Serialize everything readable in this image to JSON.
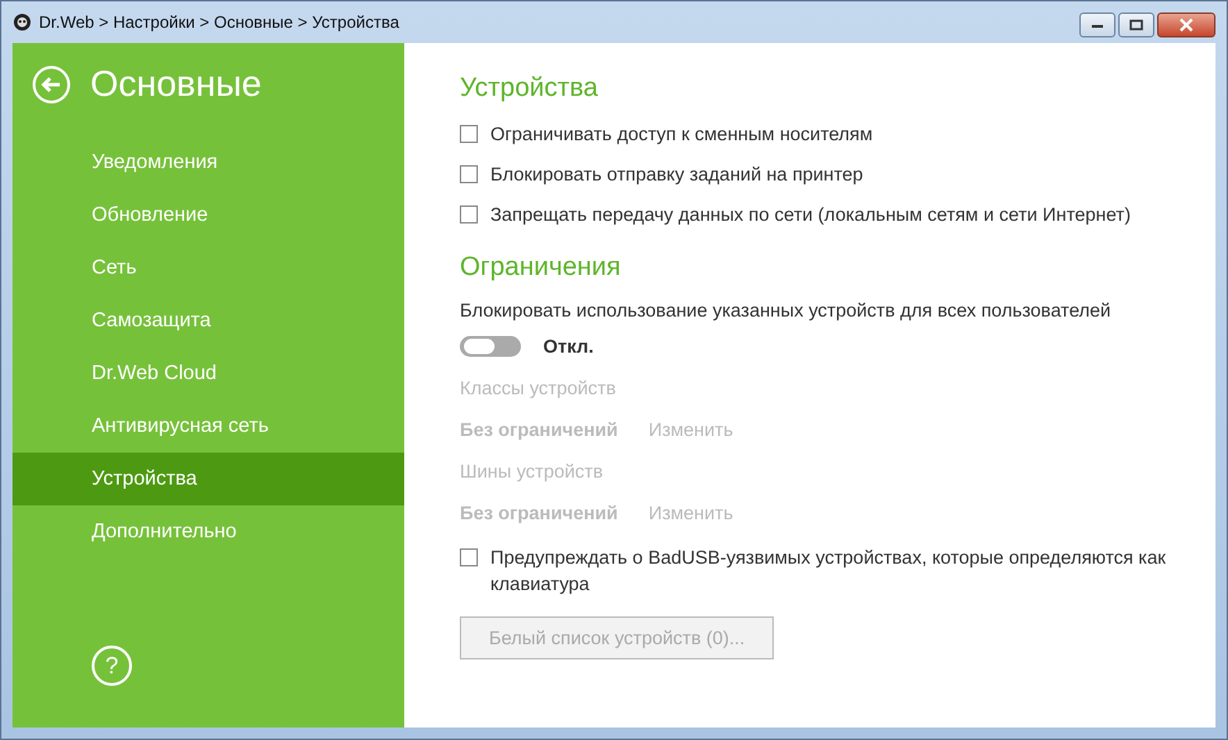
{
  "window": {
    "title": "Dr.Web > Настройки > Основные > Устройства"
  },
  "sidebar": {
    "heading": "Основные",
    "items": [
      {
        "label": "Уведомления",
        "selected": false
      },
      {
        "label": "Обновление",
        "selected": false
      },
      {
        "label": "Сеть",
        "selected": false
      },
      {
        "label": "Самозащита",
        "selected": false
      },
      {
        "label": "Dr.Web Cloud",
        "selected": false
      },
      {
        "label": "Антивирусная сеть",
        "selected": false
      },
      {
        "label": "Устройства",
        "selected": true
      },
      {
        "label": "Дополнительно",
        "selected": false
      }
    ],
    "help": "?"
  },
  "devices": {
    "title": "Устройства",
    "options": [
      {
        "label": "Ограничивать доступ к сменным носителям",
        "checked": false
      },
      {
        "label": "Блокировать отправку заданий на принтер",
        "checked": false
      },
      {
        "label": "Запрещать передачу данных по сети (локальным сетям и сети Интернет)",
        "checked": false
      }
    ]
  },
  "restrictions": {
    "title": "Ограничения",
    "description": "Блокировать использование указанных устройств для всех пользователей",
    "toggle": {
      "on": false,
      "label": "Откл."
    },
    "groups": [
      {
        "label": "Классы устройств",
        "value": "Без ограничений",
        "action": "Изменить",
        "disabled": true
      },
      {
        "label": "Шины устройств",
        "value": "Без ограничений",
        "action": "Изменить",
        "disabled": true
      }
    ],
    "badusb": {
      "label": "Предупреждать о BadUSB-уязвимых устройствах, которые определяются как клавиатура",
      "checked": false
    },
    "whitelist_button": {
      "label": "Белый список устройств (0)...",
      "disabled": true
    }
  }
}
